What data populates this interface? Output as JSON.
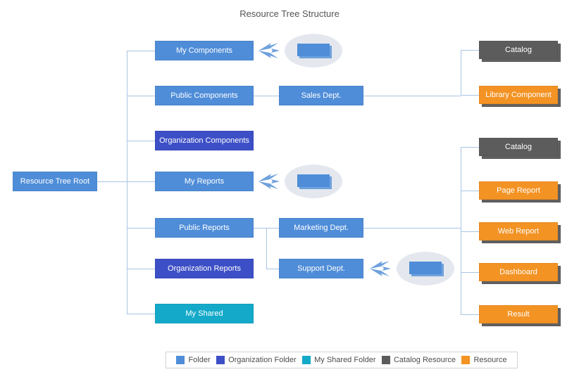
{
  "title": "Resource Tree Structure",
  "root": "Resource Tree Root",
  "col2": {
    "my_components": "My Components",
    "public_components": "Public Components",
    "org_components": "Organization Components",
    "my_reports": "My Reports",
    "public_reports": "Public Reports",
    "org_reports": "Organization Reports",
    "my_shared": "My Shared"
  },
  "col3": {
    "sales": "Sales Dept.",
    "marketing": "Marketing Dept.",
    "support": "Support Dept."
  },
  "res": {
    "catalog1": "Catalog",
    "libcomp": "Library Component",
    "catalog2": "Catalog",
    "page_report": "Page Report",
    "web_report": "Web Report",
    "dashboard": "Dashboard",
    "result": "Result"
  },
  "legend": {
    "folder": "Folder",
    "org_folder": "Organization Folder",
    "my_shared": "My Shared Folder",
    "catalog_res": "Catalog Resource",
    "resource": "Resource"
  }
}
